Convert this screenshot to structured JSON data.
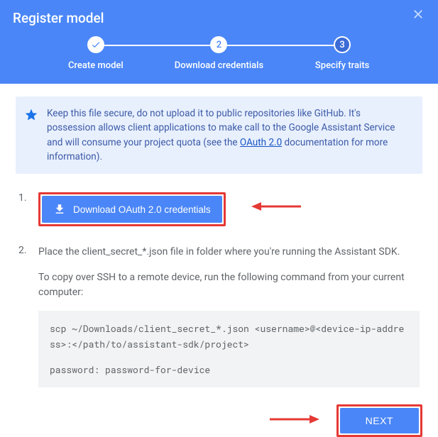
{
  "header": {
    "title": "Register model"
  },
  "stepper": {
    "steps": [
      {
        "label": "Create model",
        "num": "✓"
      },
      {
        "label": "Download credentials",
        "num": "2"
      },
      {
        "label": "Specify traits",
        "num": "3"
      }
    ]
  },
  "info": {
    "text_before": "Keep this file secure, do not upload it to public repositories like GitHub. It's possession allows client applications to make call to the Google Assistant Service and will consume your project quota (see the ",
    "link_text": "OAuth 2.0",
    "text_after": " documentation for more information)."
  },
  "list": {
    "item1_num": "1.",
    "download_label": "Download OAuth 2.0 credentials",
    "item2_num": "2.",
    "item2_text": "Place the client_secret_*.json file in folder where you're running the Assistant SDK.",
    "item2_sub": "To copy over SSH to a remote device, run the following command from your current computer:",
    "code_line1": "scp ~/Downloads/client_secret_*.json <username>@<device-ip-address>:</path/to/assistant-sdk/project>",
    "code_line2": "password: password-for-device"
  },
  "footer": {
    "next_label": "NEXT"
  }
}
